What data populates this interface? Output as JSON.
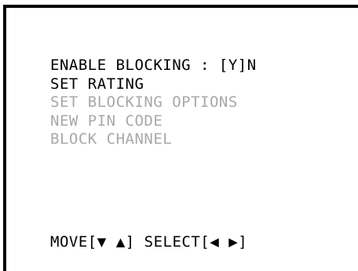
{
  "menu": {
    "items": [
      {
        "label": "ENABLE BLOCKING : [Y]N",
        "state": "active"
      },
      {
        "label": "SET RATING",
        "state": "active"
      },
      {
        "label": "SET BLOCKING OPTIONS",
        "state": "disabled"
      },
      {
        "label": "NEW PIN CODE",
        "state": "disabled"
      },
      {
        "label": "BLOCK CHANNEL",
        "state": "disabled"
      }
    ]
  },
  "footer": {
    "move_label": "MOVE[",
    "down_arrow": "▼",
    "up_arrow": "▲",
    "move_close": "]",
    "select_label": "SELECT[",
    "left_arrow": "◀",
    "right_arrow": "▶",
    "select_close": "]"
  },
  "colors": {
    "active_text": "#000000",
    "disabled_text": "#a8a8a8",
    "frame": "#000000",
    "background": "#ffffff"
  }
}
